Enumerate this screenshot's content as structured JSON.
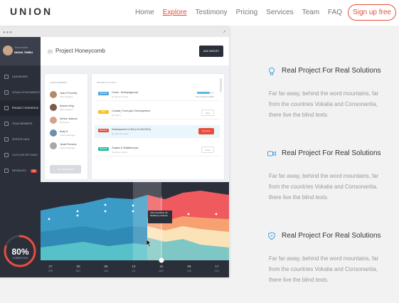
{
  "brand": {
    "logo": "UNION"
  },
  "nav": {
    "items": [
      "Home",
      "Explore",
      "Testimony",
      "Pricing",
      "Services",
      "Team",
      "FAQ"
    ],
    "active": "Explore",
    "cta": "Sign up free",
    "accent": "#e74c3c"
  },
  "app": {
    "profile": {
      "role": "Team leader",
      "name": "NIANA TIMBU"
    },
    "sidebar": [
      {
        "label": "DASHBOARD",
        "icon": "dashboard-icon"
      },
      {
        "label": "VISUAL ATTACHMENTS",
        "icon": "attachment-icon"
      },
      {
        "label": "PROJECT STATISTICS",
        "icon": "statistics-icon",
        "active": true
      },
      {
        "label": "TEAM MEMBERS",
        "icon": "team-icon"
      },
      {
        "label": "SERVER DATA",
        "icon": "server-icon"
      },
      {
        "label": "OUTLOOK SETTINGS",
        "icon": "settings-icon"
      },
      {
        "label": "MESSAGES",
        "icon": "messages-icon",
        "badge": "23"
      }
    ],
    "completion": {
      "value": "80%",
      "label": "COMPLETED",
      "fraction": 0.8
    },
    "title": "Project Honeycomb",
    "add_widget": "ADD WIDGET",
    "team": {
      "title": "TEAM MEMBERS",
      "members": [
        {
          "name": "Jack O'Connely",
          "role": "Web Designer",
          "color": "#b58a6a"
        },
        {
          "name": "Antonio King",
          "role": "Web Designer",
          "color": "#7a5a48"
        },
        {
          "name": "Denise Jackson",
          "role": "Developer",
          "color": "#d2a28a"
        },
        {
          "name": "Andy K.",
          "role": "Project Manager",
          "color": "#6f8fa8"
        },
        {
          "name": "Jamie Renome",
          "role": "Project Manager",
          "color": "#a7a7a7"
        }
      ],
      "add_button": "ADD TEAMMATE"
    },
    "activity": {
      "title": "PROJECT ACTIVITY",
      "rows": [
        {
          "tag": "DESIGN",
          "tag_color": "#4aa3df",
          "title": "Comb - Homepage.psd",
          "sub": "By Samuel Cubing",
          "progress": 0.75,
          "progress_text": "70% DOWNLOADED"
        },
        {
          "tag": "DEV",
          "tag_color": "#f5c026",
          "title": "Contact_Form.psd / Development",
          "sub": "By Andy K.",
          "action": "View"
        },
        {
          "tag": "DESIGN",
          "tag_color": "#e74c3c",
          "title": "Development UI Kit (v.12.08.2013)",
          "sub": "By Jack O'Connely",
          "action": "Remove",
          "highlight": true
        },
        {
          "tag": "DESIGN",
          "tag_color": "#1abc9c",
          "title": "Graphs & Statistics.psd",
          "sub": "By Antonio Flores",
          "action": "Push"
        }
      ]
    },
    "chart": {
      "days": [
        "27",
        "30",
        "06",
        "13",
        "22",
        "09",
        "17"
      ],
      "months": [
        "APR",
        "MAY",
        "JUN",
        "JUL",
        "MAY",
        "JUN",
        "NOV"
      ],
      "tooltip": "Client feedback 15+ Modifying mockups"
    }
  },
  "features": [
    {
      "icon": "lightbulb-icon",
      "title": "Real Project For Real Solutions",
      "text": "Far far away, behind the word mountains, far from the countries Vokalia and Consonantia, there live the blind texts."
    },
    {
      "icon": "video-icon",
      "title": "Real Project For Real Solutions",
      "text": "Far far away, behind the word mountains, far from the countries Vokalia and Consonantia, there live the blind texts."
    },
    {
      "icon": "shield-icon",
      "title": "Real Project For Real Solutions",
      "text": "Far far away, behind the word mountains, far from the countries Vokalia and Consonantia, there live the blind texts."
    }
  ]
}
